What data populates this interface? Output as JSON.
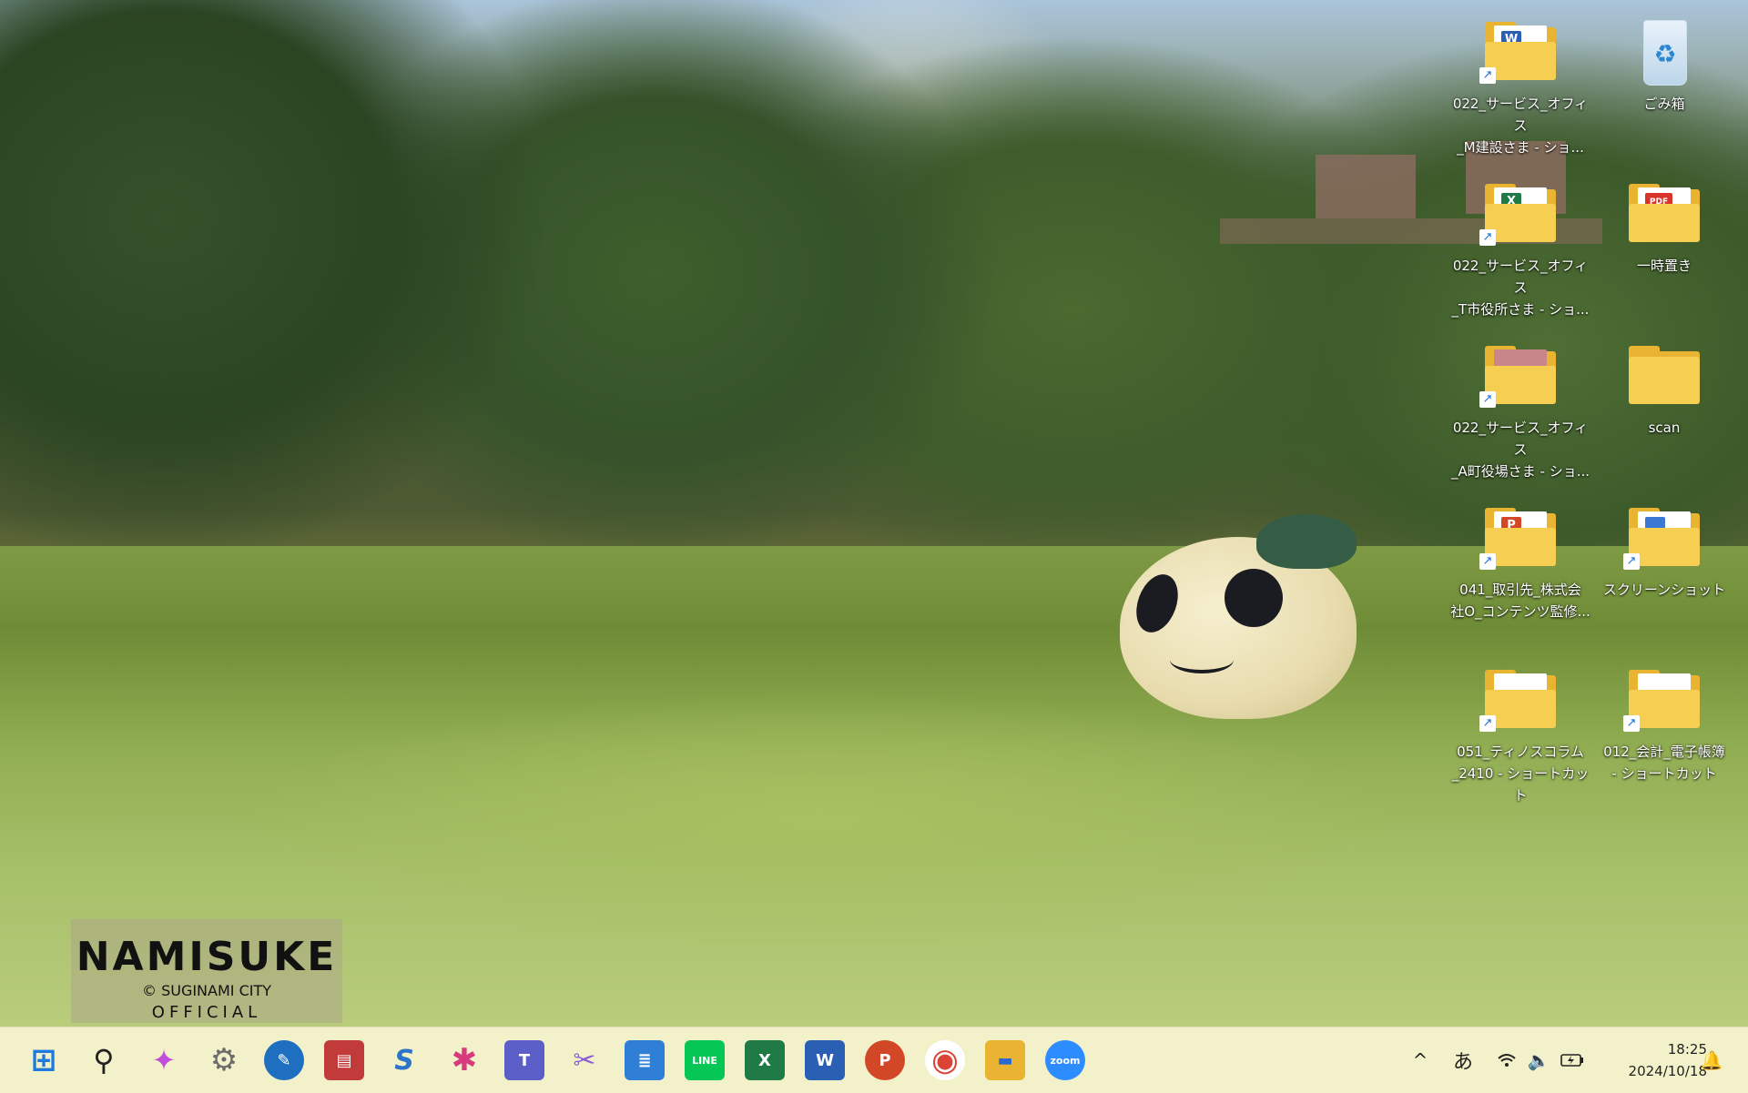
{
  "desktop": {
    "wallpaper": "wallpaper-park-grass-mascot",
    "logo": {
      "brand": "NAMISUKE",
      "sub": "© SUGINAMI CITY",
      "official": "OFFICIAL"
    },
    "icons": [
      {
        "label": "022_サービス_オフィス\n_M建設さま - ショ...",
        "type": "folder-shortcut",
        "badge": "W",
        "badge_color": "#2b5fb4"
      },
      {
        "label": "ごみ箱",
        "type": "recycle-bin"
      },
      {
        "label": "022_サービス_オフィス\n_T市役所さま - ショ...",
        "type": "folder-shortcut",
        "badge": "X",
        "badge_color": "#1f7a45"
      },
      {
        "label": "一時置き",
        "type": "folder",
        "badge": "PDF",
        "badge_color": "#d9342b"
      },
      {
        "label": "022_サービス_オフィス\n_A町役場さま - ショ...",
        "type": "folder-shortcut",
        "badge": "",
        "badge_color": "#c9868a"
      },
      {
        "label": "scan",
        "type": "folder"
      },
      {
        "label": "041_取引先_株式会\n社O_コンテンツ監修...",
        "type": "folder-shortcut",
        "badge": "P",
        "badge_color": "#d24726"
      },
      {
        "label": "スクリーンショット",
        "type": "folder-shortcut",
        "badge": "",
        "badge_color": "#3a78d4"
      },
      {
        "label": "051_ティノスコラム\n_2410 - ショートカット",
        "type": "folder-shortcut",
        "badge": "",
        "badge_color": "#cfcfcf"
      },
      {
        "label": "012_会計_電子帳簿\n - ショートカット",
        "type": "folder-shortcut",
        "badge": "",
        "badge_color": "#e0e0e0"
      }
    ]
  },
  "taskbar": {
    "pinned": [
      {
        "name": "start-icon",
        "glyph": "⊞",
        "color": "#1f7ae0"
      },
      {
        "name": "search-icon",
        "glyph": "⚲",
        "color": "#222222"
      },
      {
        "name": "copilot-icon",
        "glyph": "✦",
        "color": "#c04ed8"
      },
      {
        "name": "settings-icon",
        "glyph": "⚙",
        "color": "#6b6b6b"
      },
      {
        "name": "quick-assist-icon",
        "glyph": "✎",
        "color": "#1f6fc0"
      },
      {
        "name": "calendar-app-icon",
        "glyph": "▤",
        "color": "#c23b3b"
      },
      {
        "name": "app-s-icon",
        "glyph": "S",
        "color": "#2c74c9"
      },
      {
        "name": "slack-icon",
        "glyph": "✱",
        "color": "#d83b7d"
      },
      {
        "name": "teams-icon",
        "glyph": "T",
        "color": "#5b5fc7"
      },
      {
        "name": "snipping-tool-icon",
        "glyph": "✂",
        "color": "#8a5bd6"
      },
      {
        "name": "notepad-icon",
        "glyph": "≣",
        "color": "#2f7fd6"
      },
      {
        "name": "line-icon",
        "glyph": "LINE",
        "color": "#06c755"
      },
      {
        "name": "excel-icon",
        "glyph": "X",
        "color": "#1f7a45"
      },
      {
        "name": "word-icon",
        "glyph": "W",
        "color": "#2b5fb4"
      },
      {
        "name": "powerpoint-icon",
        "glyph": "P",
        "color": "#d24726"
      },
      {
        "name": "chrome-icon",
        "glyph": "◉",
        "color": "#db4437"
      },
      {
        "name": "file-explorer-icon",
        "glyph": "▬",
        "color": "#e8b431"
      },
      {
        "name": "zoom-icon",
        "glyph": "zoom",
        "color": "#2d8cff"
      }
    ],
    "tray": {
      "chevron": "^",
      "ime": "あ",
      "wifi": "wifi",
      "volume": "🔈",
      "battery": "battery"
    },
    "time": "18:25",
    "date": "2024/10/18",
    "notification": "🔔"
  }
}
